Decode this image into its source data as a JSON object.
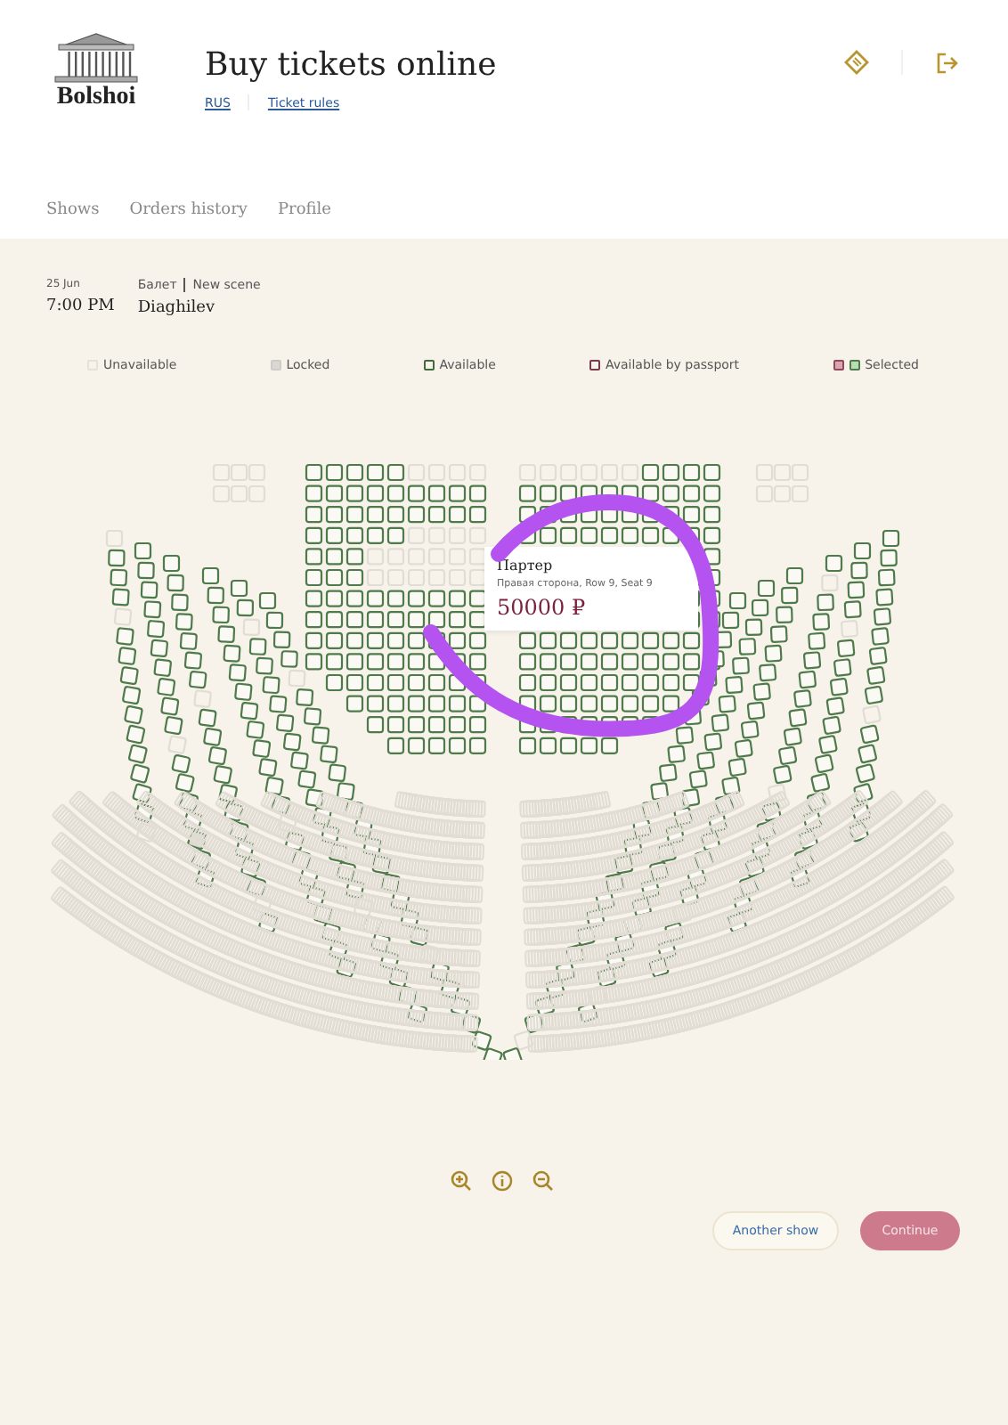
{
  "header": {
    "logo_text": "Bolshoi",
    "title": "Buy tickets online",
    "links": [
      "RUS",
      "Ticket rules"
    ]
  },
  "nav": [
    {
      "label": "Shows",
      "selected": false
    },
    {
      "label": "Orders history",
      "selected": false
    },
    {
      "label": "Profile",
      "selected": false
    }
  ],
  "event": {
    "date": "25 Jun",
    "time": "7:00 PM",
    "category": "Балет",
    "venue": "New scene",
    "name": "Diaghilev"
  },
  "legend": [
    {
      "kind": "unavailable",
      "label": "Unavailable"
    },
    {
      "kind": "locked",
      "label": "Locked"
    },
    {
      "kind": "available",
      "label": "Available"
    },
    {
      "kind": "passport",
      "label": "Available by passport"
    },
    {
      "kind": "selected",
      "label": "Selected"
    }
  ],
  "tooltip": {
    "section": "Партер",
    "place": "Правая сторона, Row 9, Seat 9",
    "price": "50000 ₽"
  },
  "buttons": {
    "secondary": "Another show",
    "primary": "Continue"
  }
}
